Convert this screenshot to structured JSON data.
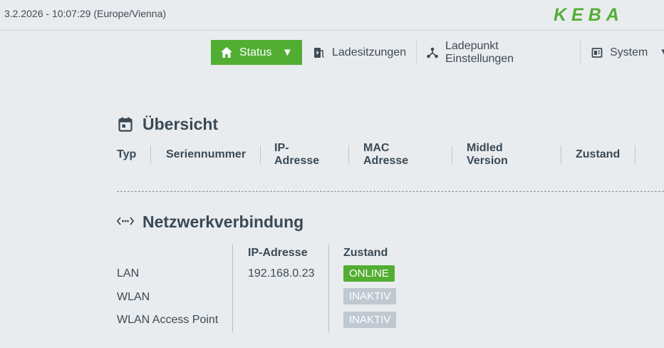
{
  "header": {
    "datetime": "3.2.2026 - 10:07:29 (Europe/Vienna)",
    "logo_text": "KEBA",
    "logo_color": "#52ae32"
  },
  "nav": {
    "status_label": "Status",
    "status_icon": "home-icon",
    "status_caret": "▼",
    "items": [
      {
        "label": "Ladesitzungen",
        "icon": "charging-session-icon"
      },
      {
        "label": "Ladepunkt Einstellungen",
        "icon": "network-node-icon"
      },
      {
        "label": "System",
        "icon": "system-icon"
      }
    ],
    "system_caret": "▼",
    "active_color": "#52ae32"
  },
  "overview": {
    "title": "Übersicht",
    "icon": "calendar-icon",
    "columns": [
      "Typ",
      "Seriennummer",
      "IP-Adresse",
      "MAC Adresse",
      "Midled Version",
      "Zustand"
    ]
  },
  "network": {
    "title": "Netzwerkverbindung",
    "icon": "network-dots-icon",
    "headers": {
      "ip": "IP-Adresse",
      "state": "Zustand"
    },
    "rows": [
      {
        "name": "LAN",
        "ip": "192.168.0.23",
        "state": "ONLINE",
        "state_kind": "online"
      },
      {
        "name": "WLAN",
        "ip": "",
        "state": "INAKTIV",
        "state_kind": "inactive"
      },
      {
        "name": "WLAN Access Point",
        "ip": "",
        "state": "INAKTIV",
        "state_kind": "inactive"
      }
    ]
  }
}
